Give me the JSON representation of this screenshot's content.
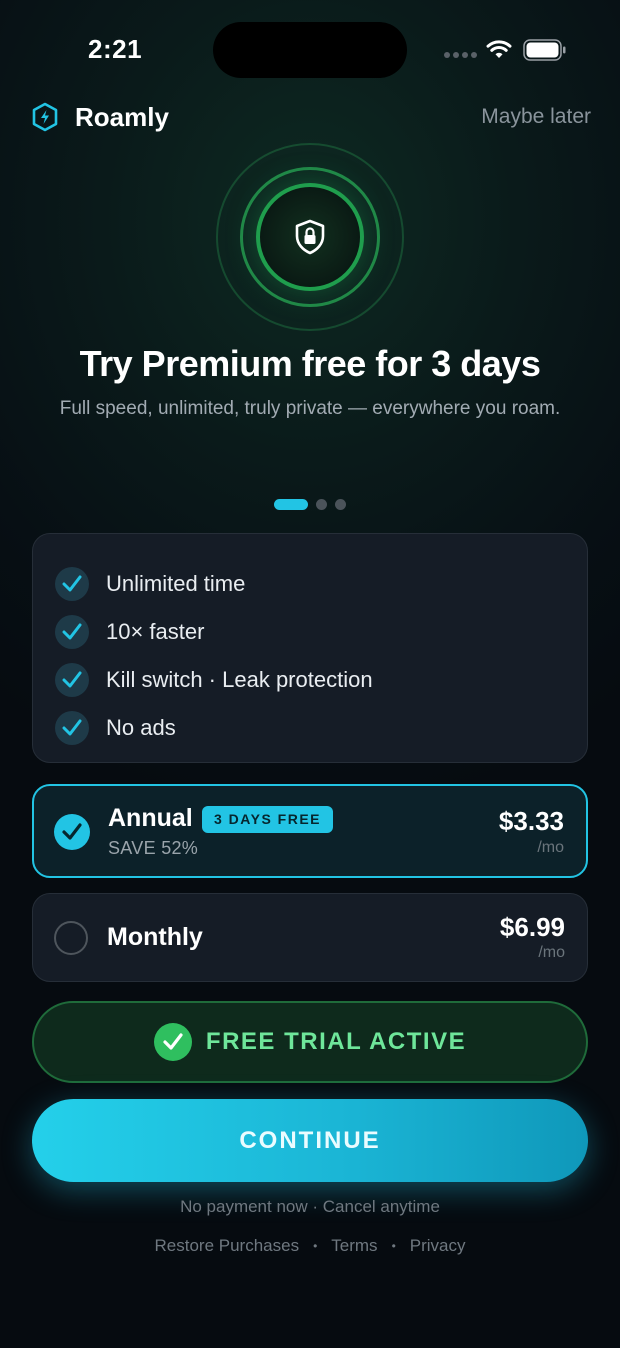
{
  "status_bar": {
    "time": "2:21"
  },
  "header": {
    "brand": "Roamly",
    "dismiss_label": "Maybe later"
  },
  "hero": {
    "title": "Try Premium free for 3 days",
    "subtitle": "Full speed, unlimited, truly private — everywhere you roam."
  },
  "pager": {
    "page_count": 3,
    "active_page": 1
  },
  "features": [
    {
      "label": "Unlimited time"
    },
    {
      "label": "10× faster"
    },
    {
      "label": "Kill switch · Leak protection"
    },
    {
      "label": "No ads"
    }
  ],
  "plans": {
    "annual": {
      "name": "Annual",
      "badge": "3 DAYS FREE",
      "savings": "SAVE 52%",
      "price": "$3.33",
      "period": "/mo",
      "selected": true
    },
    "monthly": {
      "name": "Monthly",
      "price": "$6.99",
      "period": "/mo",
      "selected": false
    }
  },
  "trial": {
    "label": "FREE TRIAL ACTIVE"
  },
  "cta": {
    "label": "CONTINUE"
  },
  "footer": {
    "note": "No payment now · Cancel anytime",
    "links": {
      "restore": "Restore Purchases",
      "terms": "Terms",
      "privacy": "Privacy"
    }
  },
  "colors": {
    "accent": "#22c4e4",
    "success": "#2fbf5f",
    "trial_text": "#6ee69a",
    "card_bg": "#151c26"
  },
  "icons": {
    "brand": "shield-bolt-icon",
    "hero": "shield-lock-icon",
    "check": "check-icon",
    "wifi": "wifi-icon",
    "battery": "battery-icon"
  }
}
